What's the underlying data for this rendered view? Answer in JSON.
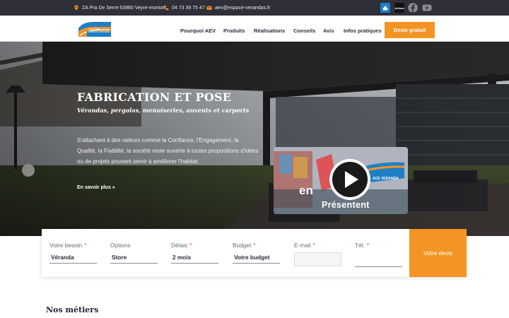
{
  "topbar": {
    "address": "ZA Pra De Serre 63960 Veyre-monton",
    "phone": "04 73 39 75 47",
    "email": "aev@espace-verandas.fr",
    "badge_2": "Artisan"
  },
  "brand": {
    "logo_text_top": "ATELIERS",
    "logo_text_bottom": "ESPACE VERANDA"
  },
  "nav": {
    "items": [
      "Pourquoi AEV",
      "Produits",
      "Réalisations",
      "Conseils",
      "Avis",
      "Infos pratiques"
    ],
    "cta": "Devis gratuit"
  },
  "hero": {
    "title": "FABRICATION ET POSE",
    "subtitle": "Vérandas, pergolas, menuiseries, auvents et carports",
    "paragraph": "S'attachant à des valeurs comme la Confiance, l'Engagement, la Qualité, la Fiabilité, la société reste ouverte à toutes propositions d'idées ou de projets pouvant servir à améliorer l'habitat.",
    "link": "En savoir plus »",
    "video_word_1": "en",
    "video_word_2": "Présentent",
    "video_logo_text": "ACE VERANDA"
  },
  "form": {
    "fields": [
      {
        "label": "Votre besoin",
        "required": "*",
        "value": "Véranda"
      },
      {
        "label": "Options",
        "required": "",
        "value": "Store"
      },
      {
        "label": "Délais",
        "required": "*",
        "value": "2 mois"
      },
      {
        "label": "Budget",
        "required": "*",
        "value": "Votre budget"
      },
      {
        "label": "E-mail",
        "required": "*",
        "value": ""
      },
      {
        "label": "Tél.",
        "required": "*",
        "value": ""
      }
    ],
    "submit": "Votre devis"
  },
  "section": {
    "title": "Nos métiers"
  },
  "colors": {
    "accent": "#f39424",
    "dark": "#2f2f3a",
    "required": "#e84a5f",
    "logo_blue": "#1e7fc6"
  },
  "icons": [
    "location-pin-icon",
    "phone-icon",
    "mail-icon",
    "facebook-icon",
    "youtube-icon",
    "play-icon"
  ]
}
